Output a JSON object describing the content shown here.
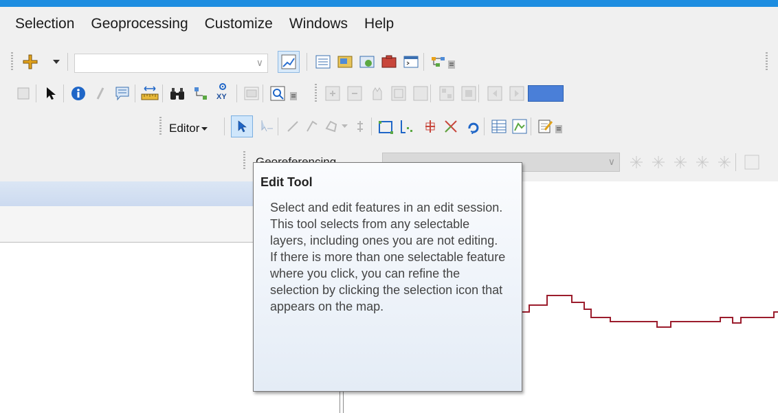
{
  "menu": [
    "Selection",
    "Geoprocessing",
    "Customize",
    "Windows",
    "Help"
  ],
  "toolbar_editor": {
    "menu_label": "Editor"
  },
  "georef": {
    "label": "Georeferencing"
  },
  "tooltip": {
    "title": "Edit Tool",
    "body": "Select and edit features in an edit session. This tool selects from any selectable layers, including ones you are not editing. If there is more than one selectable feature where you click, you can refine the selection by clicking the selection icon that appears on the map."
  },
  "colors": {
    "accent": "#1d8de0",
    "map_line": "#9b1c2c",
    "tooltip_bg": "#eef3fa"
  },
  "icons": [
    "add-data-icon",
    "select-features-icon",
    "identify-icon",
    "find-icon",
    "go-to-xy-icon",
    "measure-icon",
    "edit-tool-icon",
    "sketch-tool-icon",
    "attributes-icon",
    "sketch-properties-icon",
    "catalog-icon",
    "python-icon",
    "model-builder-icon",
    "search-icon"
  ]
}
